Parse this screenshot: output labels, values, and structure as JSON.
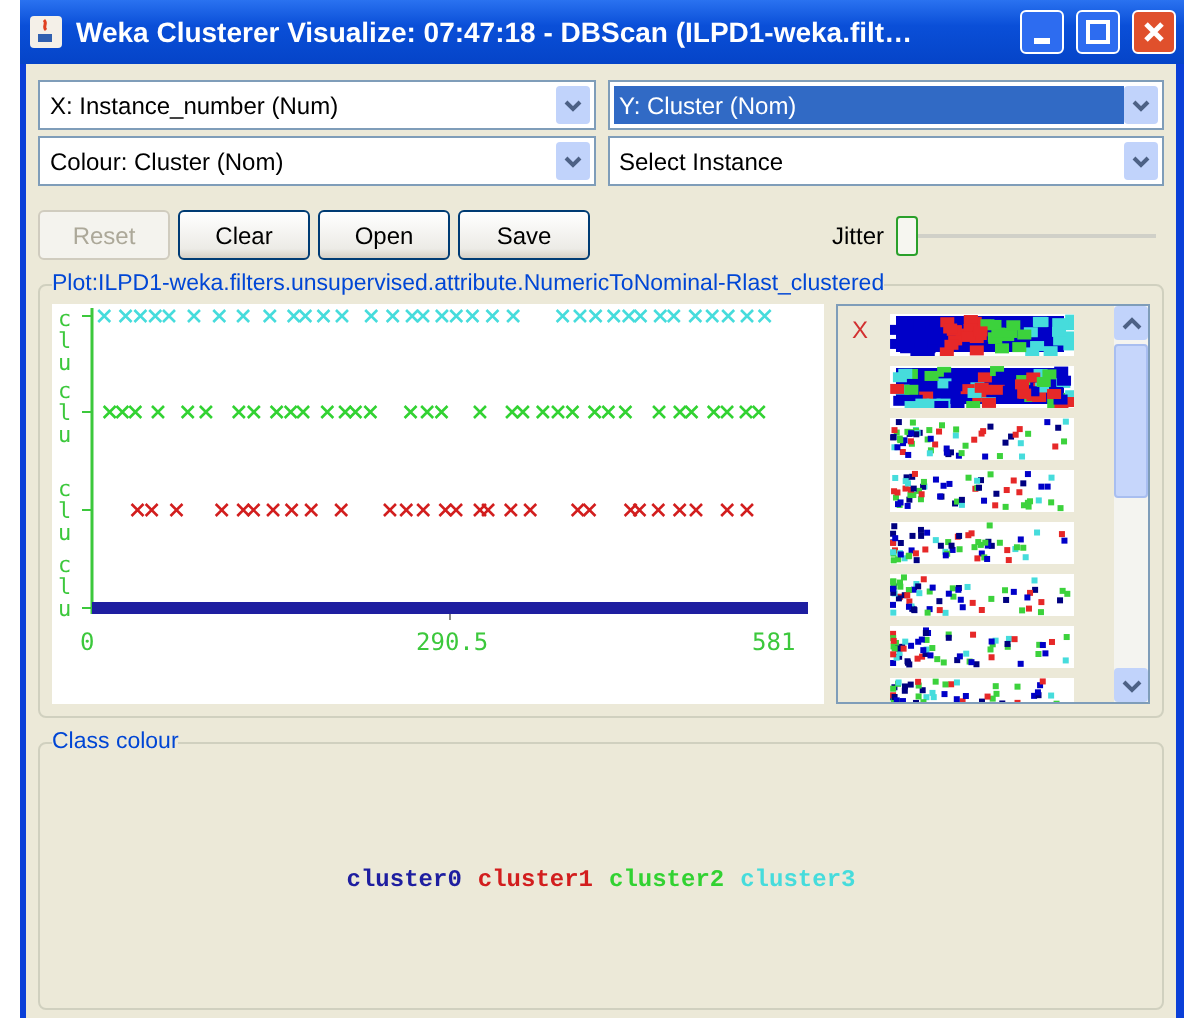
{
  "window": {
    "title": "Weka Clusterer Visualize: 07:47:18 - DBScan (ILPD1-weka.filt…"
  },
  "selectors": [
    {
      "label": "X: Instance_number (Num)",
      "selected": false
    },
    {
      "label": "Y: Cluster (Nom)",
      "selected": true
    },
    {
      "label": "Colour: Cluster (Nom)",
      "selected": false
    },
    {
      "label": "Select Instance",
      "selected": false
    }
  ],
  "buttons": [
    {
      "label": "Reset",
      "disabled": true
    },
    {
      "label": "Clear",
      "disabled": false
    },
    {
      "label": "Open",
      "disabled": false
    },
    {
      "label": "Save",
      "disabled": false
    }
  ],
  "jitter": {
    "label": "Jitter",
    "level": 0
  },
  "plot": {
    "title": "Plot:ILPD1-weka.filters.unsupervised.attribute.NumericToNominal-Rlast_clustered",
    "matrix_label": "X",
    "y_labels": [
      "clu",
      "clu",
      "clu",
      "clu"
    ],
    "x_labels": [
      "0",
      "290.5",
      "581"
    ]
  },
  "class_colour": {
    "title": "Class colour",
    "classes": [
      {
        "name": "cluster0",
        "color": "#1e1ea0"
      },
      {
        "name": "cluster1",
        "color": "#d21e1e"
      },
      {
        "name": "cluster2",
        "color": "#32d232"
      },
      {
        "name": "cluster3",
        "color": "#46dcdc"
      }
    ]
  }
}
